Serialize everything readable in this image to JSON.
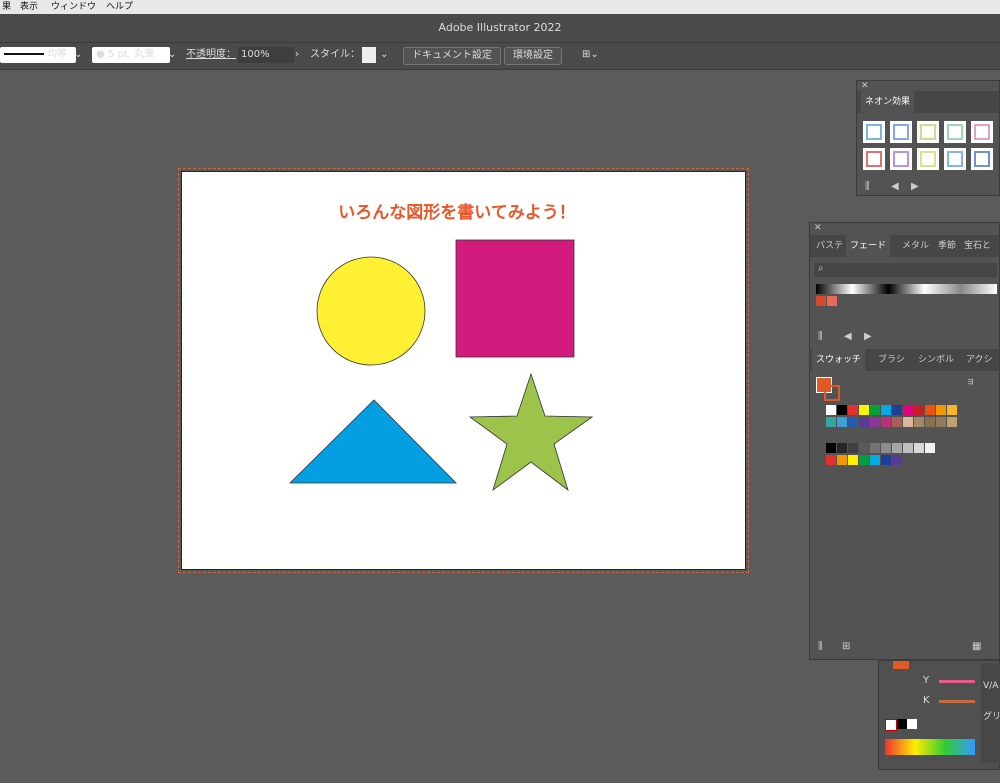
{
  "menubar": {
    "items": [
      "果",
      "表示",
      "ウィンドウ",
      "ヘルプ"
    ]
  },
  "window": {
    "title": "Adobe Illustrator 2022"
  },
  "control_bar": {
    "stroke_profile": "均等",
    "brush": "5 pt. 丸筆",
    "opacity_label": "不透明度：",
    "opacity_value": "100%",
    "style_label": "スタイル：",
    "doc_setup": "ドキュメント設定",
    "prefs": "環境設定"
  },
  "artboard": {
    "title": "いろんな図形を書いてみよう！",
    "shapes": [
      {
        "name": "circle",
        "color": "#fff033"
      },
      {
        "name": "square",
        "color": "#d21b7d"
      },
      {
        "name": "triangle",
        "color": "#049fe2"
      },
      {
        "name": "star",
        "color": "#9cc34a"
      }
    ]
  },
  "neon_panel": {
    "tab": "ネオン効果",
    "swatch_colors": [
      "#7fb5d8",
      "#8aa6e0",
      "#d6d88a",
      "#9fd6b0",
      "#e0a0c8",
      "#e06f6f",
      "#c090d8",
      "#d8e090",
      "#7fb8e8",
      "#6f8fe0"
    ]
  },
  "gradient_panel": {
    "tabs": [
      "パステ",
      "フェード",
      "メタル",
      "季節",
      "宝石と"
    ],
    "active_tab": "フェード"
  },
  "swatches_panel": {
    "tabs": [
      "スウォッチ",
      "ブラシ",
      "シンボル",
      "アクショ"
    ],
    "active_tab": "スウォッチ",
    "fill_color": "#e05a28",
    "colors_row1": [
      "#ffffff",
      "#000000",
      "#e6302d",
      "#fff100",
      "#04a03a",
      "#05a9e4",
      "#1f3f96",
      "#e4007f",
      "#c31f24",
      "#e95513",
      "#f39800",
      "#f8b62d"
    ],
    "colors_row2": [
      "#2fa6a0",
      "#3fa0d8",
      "#2a5aa8",
      "#5a3a96",
      "#8a3a96",
      "#b8307a",
      "#a8605a",
      "#d8b898",
      "#a88868",
      "#887050",
      "#907a60",
      "#c0a070"
    ],
    "colors_gray": [
      "#000000",
      "#262626",
      "#404040",
      "#595959",
      "#737373",
      "#8c8c8c",
      "#a6a6a6",
      "#bfbfbf",
      "#d9d9d9",
      "#f2f2f2"
    ],
    "colors_bright": [
      "#e6302d",
      "#f39800",
      "#fff100",
      "#04a03a",
      "#05a9e4",
      "#1f3f96",
      "#5a3a96"
    ]
  },
  "color_panel": {
    "y_label": "Y",
    "k_label": "K",
    "side_labels": [
      "V/A",
      "グリ"
    ]
  }
}
